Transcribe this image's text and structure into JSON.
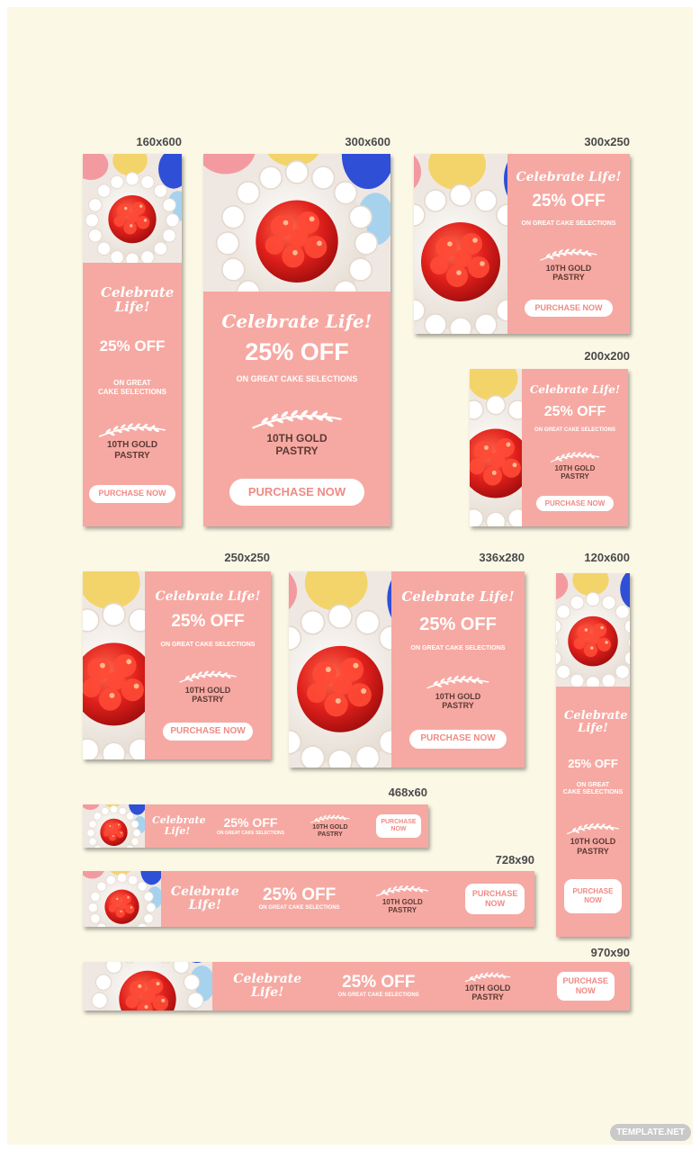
{
  "ad": {
    "headline": "Celebrate Life!",
    "offer": "25% OFF",
    "subline": "ON GREAT CAKE SELECTIONS",
    "subline_stacked": "ON GREAT\nCAKE SELECTIONS",
    "brand": "10TH GOLD\nPASTRY",
    "cta": "PURCHASE NOW",
    "cta_stacked": "PURCHASE\nNOW"
  },
  "sizes": {
    "s160x600": "160x600",
    "s300x600": "300x600",
    "s300x250": "300x250",
    "s200x200": "200x200",
    "s250x250": "250x250",
    "s336x280": "336x280",
    "s120x600": "120x600",
    "s468x60": "468x60",
    "s728x90": "728x90",
    "s970x90": "970x90"
  },
  "watermark": "TEMPLATE.NET",
  "colors": {
    "page_background": "#fcf8e6",
    "banner_pink": "#f6a9a2",
    "brand_text": "#5b3a36",
    "button_text": "#f08a85",
    "label_text": "#4a4a4a"
  }
}
